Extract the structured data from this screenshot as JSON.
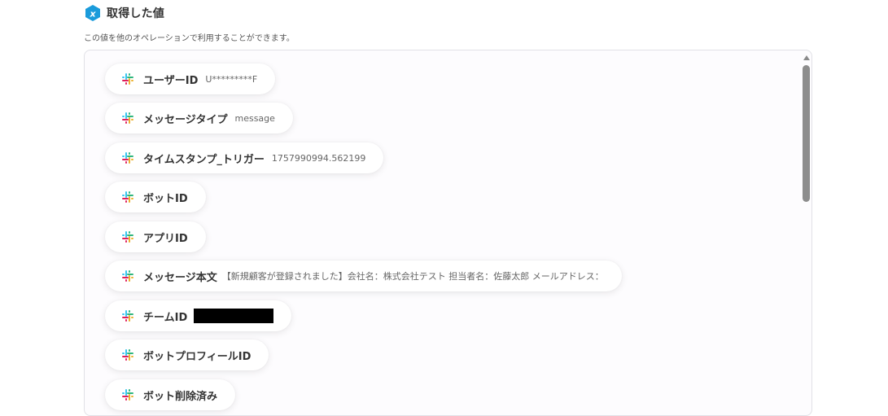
{
  "header": {
    "title": "取得した値",
    "icon": "variable-hex-icon",
    "icon_color": "#1a9bdb"
  },
  "description": "この値を他のオペレーションで利用することができます。",
  "items": [
    {
      "label": "ユーザーID",
      "value": "U*********F"
    },
    {
      "label": "メッセージタイプ",
      "value": "message"
    },
    {
      "label": "タイムスタンプ_トリガー",
      "value": "1757990994.562199"
    },
    {
      "label": "ボットID",
      "value": ""
    },
    {
      "label": "アプリID",
      "value": ""
    },
    {
      "label": "メッセージ本文",
      "value": "【新規顧客が登録されました】会社名：株式会社テスト 担当者名：佐藤太郎 メールアドレス："
    },
    {
      "label": "チームID",
      "value": ""
    },
    {
      "label": "ボットプロフィールID",
      "value": ""
    },
    {
      "label": "ボット削除済み",
      "value": ""
    }
  ],
  "colors": {
    "slack_blue": "#36C5F0",
    "slack_green": "#2EB67D",
    "slack_red": "#E01E5A",
    "slack_yellow": "#ECB22E"
  }
}
